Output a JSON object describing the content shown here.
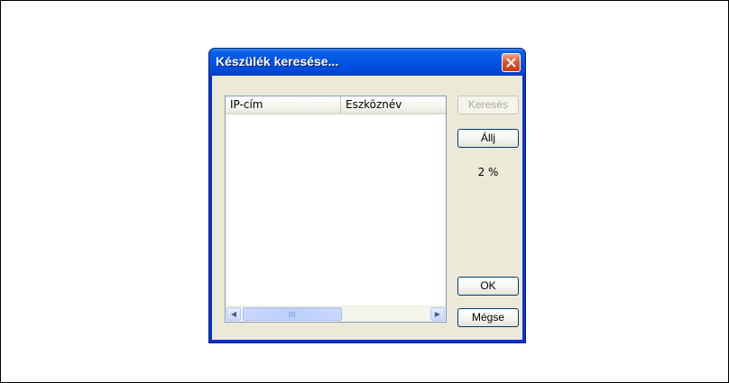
{
  "dialog": {
    "title": "Készülék keresése...",
    "close_icon": "close-icon"
  },
  "list": {
    "columns": [
      "IP-cím",
      "Eszköznév"
    ],
    "rows": []
  },
  "buttons": {
    "search": {
      "label": "Keresés",
      "enabled": false
    },
    "stop": {
      "label": "Állj",
      "enabled": true
    },
    "ok": {
      "label": "OK",
      "enabled": true
    },
    "cancel": {
      "label": "Mégse",
      "enabled": true
    }
  },
  "progress": {
    "text": "2 %",
    "percent": 2
  },
  "colors": {
    "titlebar": "#0054e3",
    "window_border": "#0831d9",
    "client_bg": "#ece9d8",
    "close_button": "#e0562f"
  }
}
